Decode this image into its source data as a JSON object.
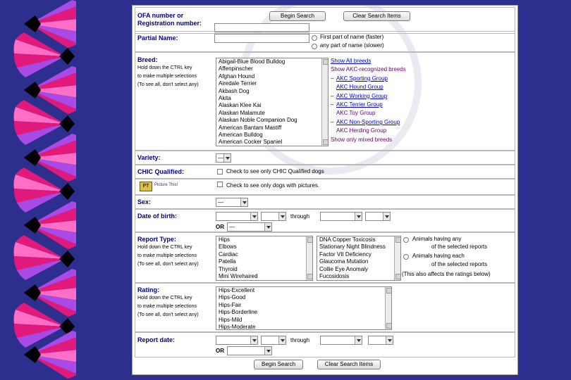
{
  "colors": {
    "background": "#2d2f8f",
    "label": "#000080",
    "link": "#0000cc",
    "link_visited": "#660066",
    "fan_magenta": "#e0197a",
    "fan_pink": "#ff6fc8",
    "fan_purple": "#a94ae6",
    "fan_black": "#000000"
  },
  "ofa": {
    "label_line1": "OFA number or",
    "label_line2": "Registration number:"
  },
  "buttons": {
    "begin_search": "Begin Search",
    "clear_search": "Clear Search Items"
  },
  "partial_name": {
    "label": "Partial Name:",
    "opt_first": "First part of name (faster)",
    "opt_any": "any part of name (slower)"
  },
  "breed": {
    "label": "Breed:",
    "hint1": "Hold down the CTRL key",
    "hint2": "to make multiple selections",
    "hint3": "(To see all, don't select any)",
    "options": [
      "Abigail-Blue Blood Bulldog",
      "Affenpinscher",
      "Afghan Hound",
      "Airedale Terrier",
      "Akbash Dog",
      "Akita",
      "Alaskan Klee Kai",
      "Alaskan Malamute",
      "Alaskan Noble Companion Dog",
      "American Bantam Mastiff",
      "American Bulldog",
      "American Cocker Spaniel"
    ],
    "links": [
      {
        "text": "Show All breeds",
        "style": "blue",
        "indent": false,
        "dash": false
      },
      {
        "text": "Show AKC-recognized breeds",
        "style": "purple",
        "indent": false,
        "dash": false
      },
      {
        "text": "AKC Sporting Group",
        "style": "blue",
        "indent": true,
        "dash": true
      },
      {
        "text": "AKC Hound Group",
        "style": "blue",
        "indent": true,
        "dash": false
      },
      {
        "text": "AKC Working Group",
        "style": "blue",
        "indent": true,
        "dash": true
      },
      {
        "text": "AKC Terrier Group",
        "style": "blue",
        "indent": true,
        "dash": true
      },
      {
        "text": "AKC Toy Group",
        "style": "purple",
        "indent": true,
        "dash": false
      },
      {
        "text": "AKC Non-Sporting Group",
        "style": "blue",
        "indent": true,
        "dash": true
      },
      {
        "text": "AKC Herding Group",
        "style": "purple",
        "indent": true,
        "dash": false
      },
      {
        "text": "Show only mixed breeds",
        "style": "purple",
        "indent": false,
        "dash": false
      }
    ]
  },
  "variety": {
    "label": "Variety:",
    "value": "—"
  },
  "chic": {
    "label": "CHIC Qualified:",
    "checkbox_label": "Check to see only CHIC Qualified dogs"
  },
  "pictures": {
    "logo_text": "Picture This!",
    "checkbox_label": "Check to see only dogs with pictures."
  },
  "sex": {
    "label": "Sex:",
    "value": "—"
  },
  "dob": {
    "label": "Date of birth:",
    "through": "through",
    "or": "OR",
    "or_value": "—"
  },
  "report_type": {
    "label": "Report Type:",
    "hint1": "Hold down the CTRL key",
    "hint2": "to make multiple selections",
    "hint3": "(To see all, don't select any)",
    "list1": [
      "Hips",
      "Elbows",
      "Cardiac",
      "Patella",
      "Thyroid",
      "Mini Wirehaired"
    ],
    "list2": [
      "DNA Copper Toxicosis",
      "Stationary Night Blindness",
      "Factor VII Deficiency",
      "Glaucoma Mutation",
      "Collie Eye Anomaly",
      "Fucosidosis"
    ],
    "opt_any": "Animals having any",
    "opt_any2": "of the selected reports",
    "opt_each": "Animals having each",
    "opt_each2": "of the selected reports",
    "note": "(This also affects the ratings below)"
  },
  "rating": {
    "label": "Rating:",
    "hint1": "Hold down the CTRL key",
    "hint2": "to make multiple selections",
    "hint3": "(To see all, don't select any)",
    "options": [
      "Hips-Excellent",
      "Hips-Good",
      "Hips-Fair",
      "Hips-Borderline",
      "Hips-Mild",
      "Hips-Moderate"
    ]
  },
  "report_date": {
    "label": "Report date:",
    "through": "through",
    "or": "OR"
  },
  "bottom_buttons": {
    "begin": "Begin Search",
    "clear": "Clear Search Items"
  }
}
